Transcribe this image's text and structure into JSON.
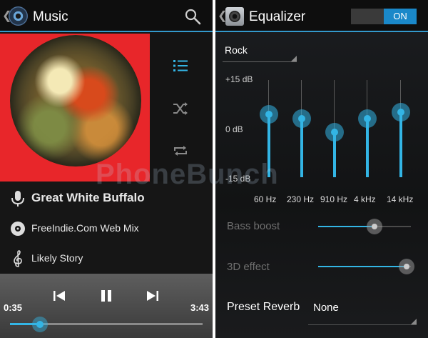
{
  "music": {
    "title": "Music",
    "track": {
      "title": "Great White Buffalo",
      "album": "FreeIndie.Com Web Mix",
      "artist": "Likely Story"
    },
    "player": {
      "elapsed": "0:35",
      "duration": "3:43",
      "progress": 0.157
    },
    "icons": [
      "back-icon",
      "music-app-icon",
      "search-icon",
      "queue-list-icon",
      "shuffle-icon",
      "repeat-icon",
      "microphone-icon",
      "disc-icon",
      "treble-clef-icon",
      "previous-icon",
      "pause-icon",
      "next-icon"
    ]
  },
  "equalizer": {
    "title": "Equalizer",
    "toggle_label": "ON",
    "preset": "Rock",
    "db_labels": {
      "max": "+15 dB",
      "mid": "0 dB",
      "min": "-15 dB"
    },
    "bands": [
      {
        "freq": "60 Hz",
        "level_db": 4.5
      },
      {
        "freq": "230 Hz",
        "level_db": 3
      },
      {
        "freq": "910 Hz",
        "level_db": -1
      },
      {
        "freq": "4 kHz",
        "level_db": 3
      },
      {
        "freq": "14 kHz",
        "level_db": 5
      }
    ],
    "bass_boost": {
      "label": "Bass boost",
      "level": 0.61
    },
    "effect_3d": {
      "label": "3D effect",
      "level": 0.95
    },
    "reverb": {
      "label": "Preset Reverb",
      "value": "None"
    }
  },
  "colors": {
    "accent": "#33b5e5",
    "album_background": "#e8262a",
    "toggle_on": "#1a88c9"
  },
  "watermark": "PhoneBunch"
}
